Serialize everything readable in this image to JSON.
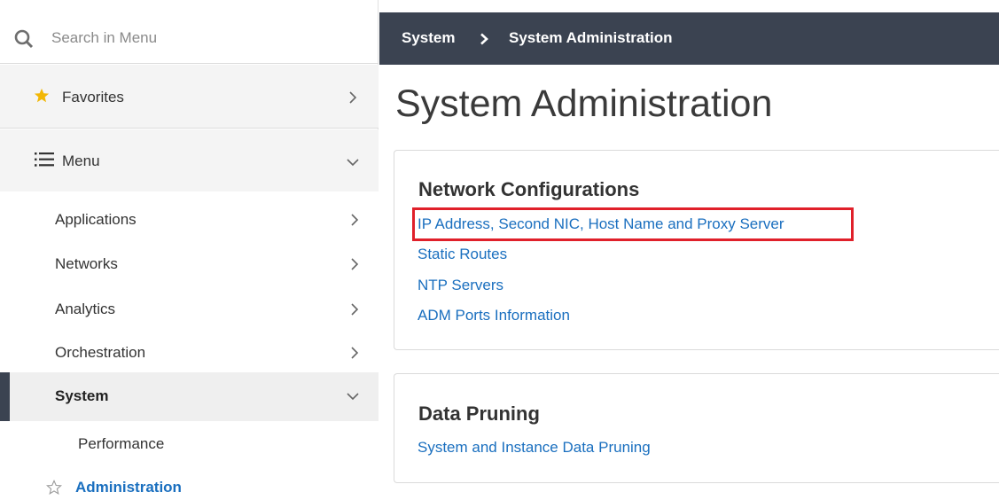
{
  "search": {
    "placeholder": "Search in Menu"
  },
  "favorites": {
    "label": "Favorites"
  },
  "menu": {
    "label": "Menu",
    "items": [
      {
        "label": "Applications"
      },
      {
        "label": "Networks"
      },
      {
        "label": "Analytics"
      },
      {
        "label": "Orchestration"
      }
    ],
    "system": {
      "label": "System",
      "children": [
        {
          "label": "Performance"
        },
        {
          "label": "Administration"
        }
      ]
    }
  },
  "breadcrumb": {
    "parent": "System",
    "current": "System Administration"
  },
  "page": {
    "title": "System Administration"
  },
  "sections": [
    {
      "title": "Network Configurations",
      "links": [
        "IP Address, Second NIC, Host Name and Proxy Server",
        "Static Routes",
        "NTP Servers",
        "ADM Ports Information"
      ]
    },
    {
      "title": "Data Pruning",
      "links": [
        "System and Instance Data Pruning"
      ]
    }
  ],
  "colors": {
    "topbar": "#3b4351",
    "link": "#1a6fbf",
    "highlight": "#e0202a",
    "favorite_star": "#f2b705"
  }
}
